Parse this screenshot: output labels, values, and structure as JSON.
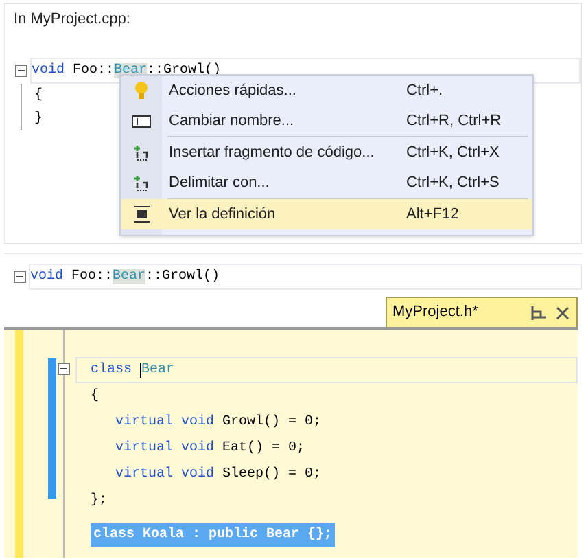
{
  "caption": "In MyProject.cpp:",
  "top_editor": {
    "header_line": [
      {
        "text": "void",
        "kind": "keyword"
      },
      {
        "text": " Foo::",
        "kind": "plain"
      },
      {
        "text": "Bear",
        "kind": "type",
        "highlighted": true
      },
      {
        "text": "::Growl()",
        "kind": "plain"
      }
    ],
    "body_lines": [
      "{",
      "}"
    ]
  },
  "context_menu": [
    {
      "kind": "bulb",
      "label": "Acciones rápidas...",
      "shortcut": "Ctrl+.",
      "selected": false,
      "separator_after": false
    },
    {
      "kind": "rename",
      "label": "Cambiar nombre...",
      "shortcut": "Ctrl+R, Ctrl+R",
      "selected": false,
      "separator_after": true
    },
    {
      "kind": "snippet",
      "label": "Insertar fragmento de código...",
      "shortcut": "Ctrl+K, Ctrl+X",
      "selected": false,
      "separator_after": false
    },
    {
      "kind": "snippet",
      "label": "Delimitar con...",
      "shortcut": "Ctrl+K, Ctrl+S",
      "selected": false,
      "separator_after": true
    },
    {
      "kind": "definition",
      "label": "Ver la definición",
      "shortcut": "Alt+F12",
      "selected": true,
      "separator_after": false
    }
  ],
  "bottom_editor": {
    "header_line": [
      {
        "text": "void",
        "kind": "keyword"
      },
      {
        "text": " Foo::",
        "kind": "plain"
      },
      {
        "text": "Bear",
        "kind": "type",
        "highlighted": true
      },
      {
        "text": "::Growl()",
        "kind": "plain"
      }
    ],
    "peek": {
      "tab_title": "MyProject.h*",
      "lines": [
        {
          "fold": true,
          "current": true,
          "selected": false,
          "tokens": [
            {
              "text": "class ",
              "kind": "keyword"
            },
            {
              "text": "Bear",
              "kind": "type",
              "cursor": true
            }
          ]
        },
        {
          "fold": false,
          "current": false,
          "selected": false,
          "tokens": [
            {
              "text": "{",
              "kind": "plain"
            }
          ]
        },
        {
          "fold": false,
          "current": false,
          "selected": false,
          "indented": true,
          "tokens": [
            {
              "text": "virtual void",
              "kind": "keyword"
            },
            {
              "text": " Growl() = 0;",
              "kind": "plain"
            }
          ]
        },
        {
          "fold": false,
          "current": false,
          "selected": false,
          "indented": true,
          "tokens": [
            {
              "text": "virtual void",
              "kind": "keyword"
            },
            {
              "text": " Eat() = 0;",
              "kind": "plain"
            }
          ]
        },
        {
          "fold": false,
          "current": false,
          "selected": false,
          "indented": true,
          "tokens": [
            {
              "text": "virtual void",
              "kind": "keyword"
            },
            {
              "text": " Sleep() = 0;",
              "kind": "plain"
            }
          ]
        },
        {
          "fold": false,
          "current": false,
          "selected": false,
          "tokens": [
            {
              "text": "};",
              "kind": "plain"
            }
          ]
        },
        {
          "fold": false,
          "current": false,
          "selected": true,
          "gap_before": true,
          "tokens": [
            {
              "text": "class Koala : public Bear {};"
            }
          ]
        }
      ]
    }
  }
}
